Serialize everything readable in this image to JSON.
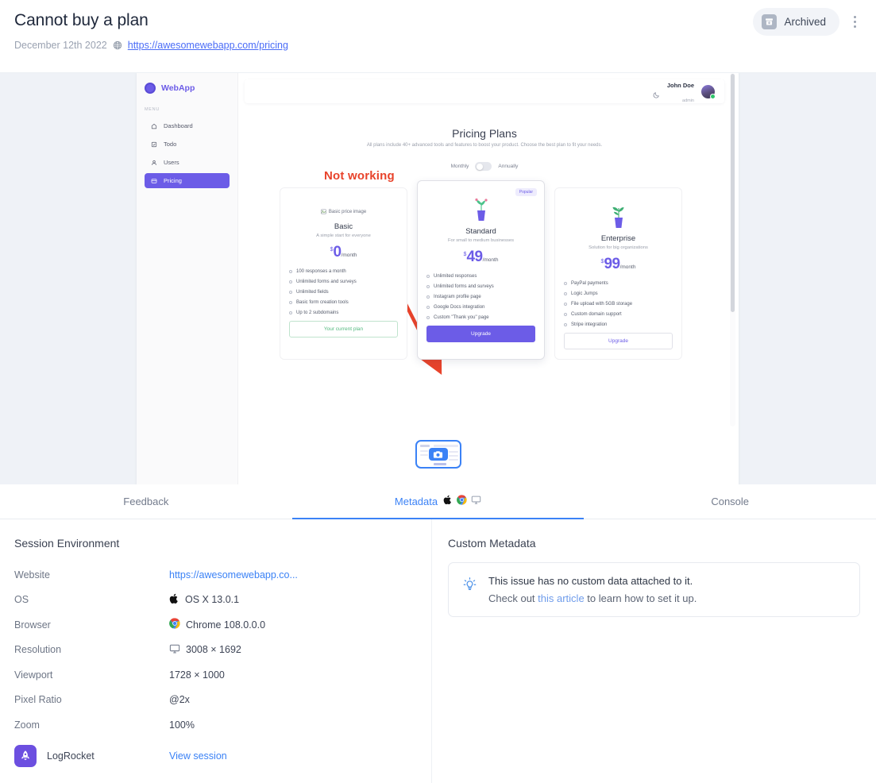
{
  "header": {
    "title": "Cannot buy a plan",
    "date": "December 12th 2022",
    "url": "https://awesomewebapp.com/pricing",
    "archived_label": "Archived",
    "globe_icon": "globe-icon",
    "archive_icon": "archive-box-icon",
    "kebab_icon": "more-vertical-icon"
  },
  "preview": {
    "app": {
      "logo_text": "WebApp",
      "menu_label": "MENU",
      "nav": [
        {
          "label": "Dashboard",
          "icon": "home-icon",
          "active": false
        },
        {
          "label": "Todo",
          "icon": "checklist-icon",
          "active": false
        },
        {
          "label": "Users",
          "icon": "user-icon",
          "active": false
        },
        {
          "label": "Pricing",
          "icon": "card-icon",
          "active": true
        }
      ],
      "user_name": "John Doe",
      "user_role": "admin",
      "moon_icon": "moon-icon",
      "avatar": "avatar"
    },
    "pricing": {
      "title": "Pricing Plans",
      "subtitle": "All plans include 40+ advanced tools and features to boost your product. Choose the best plan to fit your needs.",
      "toggle_left": "Monthly",
      "toggle_right": "Annually",
      "annotation": "Not working",
      "plans": [
        {
          "name": "Basic",
          "desc": "A simple start for everyone",
          "currency": "$",
          "amount": "0",
          "period": "/month",
          "image_alt": "Basic price image",
          "badge": "",
          "features": [
            "100 responses a month",
            "Unlimited forms and surveys",
            "Unlimited fields",
            "Basic form creation tools",
            "Up to 2 subdomains"
          ],
          "cta": "Your current plan"
        },
        {
          "name": "Standard",
          "desc": "For small to medium businesses",
          "currency": "$",
          "amount": "49",
          "period": "/month",
          "badge": "Popular",
          "features": [
            "Unlimited responses",
            "Unlimited forms and surveys",
            "Instagram profile page",
            "Google Docs integration",
            "Custom \"Thank you\" page"
          ],
          "cta": "Upgrade"
        },
        {
          "name": "Enterprise",
          "desc": "Solution for big organizations",
          "currency": "$",
          "amount": "99",
          "period": "/month",
          "badge": "",
          "features": [
            "PayPal payments",
            "Logic Jumps",
            "File upload with 5GB storage",
            "Custom domain support",
            "Stripe integration"
          ],
          "cta": "Upgrade"
        }
      ]
    },
    "thumbnail_icon": "camera-icon"
  },
  "tabs": [
    {
      "label": "Feedback",
      "active": false
    },
    {
      "label": "Metadata",
      "active": true,
      "icons": [
        "apple-icon",
        "chrome-icon",
        "monitor-icon"
      ]
    },
    {
      "label": "Console",
      "active": false
    }
  ],
  "session_environment": {
    "title": "Session Environment",
    "rows": [
      {
        "key": "Website",
        "value": "https://awesomewebapp.co...",
        "icon": "",
        "link": true
      },
      {
        "key": "OS",
        "value": "OS X 13.0.1",
        "icon": "apple-icon",
        "link": false
      },
      {
        "key": "Browser",
        "value": "Chrome 108.0.0.0",
        "icon": "chrome-icon",
        "link": false
      },
      {
        "key": "Resolution",
        "value": "3008 × 1692",
        "icon": "monitor-icon",
        "link": false
      },
      {
        "key": "Viewport",
        "value": "1728 × 1000",
        "icon": "",
        "link": false
      },
      {
        "key": "Pixel Ratio",
        "value": "@2x",
        "icon": "",
        "link": false
      },
      {
        "key": "Zoom",
        "value": "100%",
        "icon": "",
        "link": false
      }
    ],
    "logrocket": {
      "name": "LogRocket",
      "icon": "rocket-icon",
      "action": "View session"
    }
  },
  "custom_metadata": {
    "title": "Custom Metadata",
    "icon": "lightbulb-icon",
    "line1": "This issue has no custom data attached to it.",
    "line2_before": "Check out ",
    "line2_link": "this article",
    "line2_after": " to learn how to set it up."
  },
  "colors": {
    "accent_blue": "#3b82f6",
    "purple": "#6c5ce7",
    "annotation_red": "#e8432b",
    "preview_bg": "#eff2f7"
  }
}
